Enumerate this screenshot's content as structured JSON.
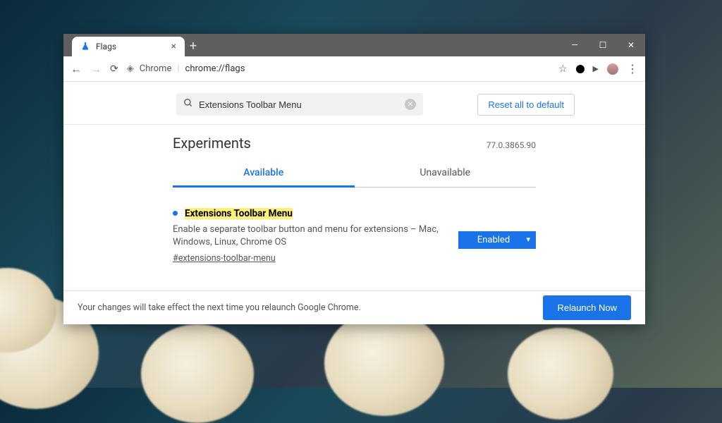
{
  "window": {
    "tab_title": "Flags"
  },
  "toolbar": {
    "chip": "Chrome",
    "url": "chrome://flags"
  },
  "search": {
    "value": "Extensions Toolbar Menu"
  },
  "buttons": {
    "reset": "Reset all to default",
    "relaunch": "Relaunch Now"
  },
  "page": {
    "heading": "Experiments",
    "version": "77.0.3865.90"
  },
  "tabs": {
    "available": "Available",
    "unavailable": "Unavailable"
  },
  "flag": {
    "title": "Extensions Toolbar Menu",
    "description": "Enable a separate toolbar button and menu for extensions – Mac, Windows, Linux, Chrome OS",
    "hash": "#extensions-toolbar-menu",
    "state": "Enabled"
  },
  "footer": {
    "message": "Your changes will take effect the next time you relaunch Google Chrome."
  }
}
